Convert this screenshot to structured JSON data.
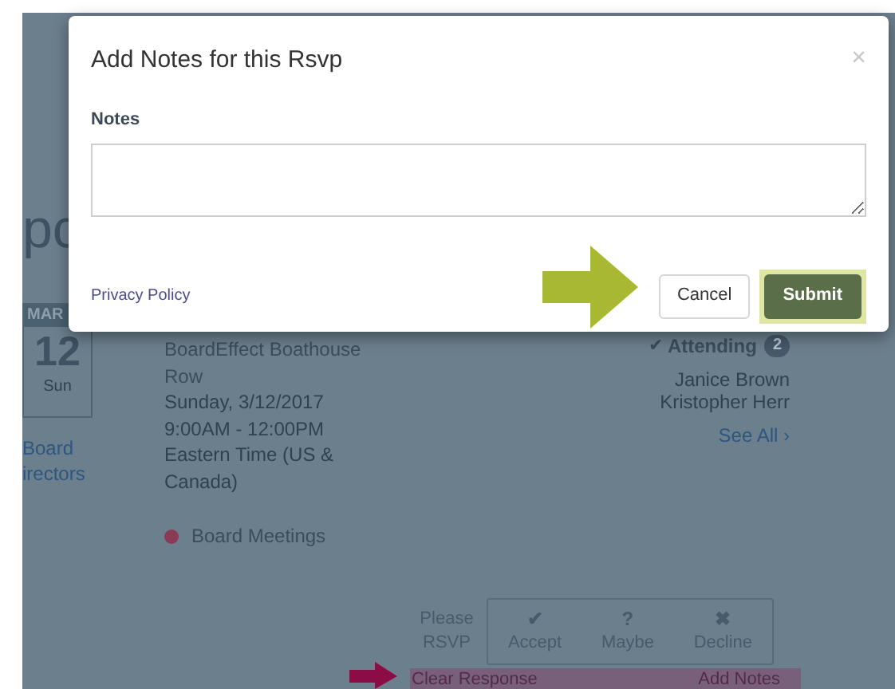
{
  "page": {
    "title_fragment": "pc",
    "date": {
      "month": "MAR",
      "day": "12",
      "weekday": "Sun"
    },
    "group_link": {
      "lines": [
        "Board",
        "irectors"
      ]
    },
    "event": {
      "location": "BoardEffect Boathouse Row",
      "date": "Sunday, 3/12/2017",
      "time": "9:00AM - 12:00PM",
      "timezone": "Eastern Time (US & Canada)"
    },
    "category": {
      "label": "Board Meetings",
      "color": "#8a3a55"
    },
    "attending": {
      "label": "Attending",
      "count": "2",
      "names": [
        "Janice Brown",
        "Kristopher Herr"
      ],
      "see_all": "See All ›"
    },
    "rsvp": {
      "prompt": "Please RSVP",
      "options": [
        {
          "icon": "✔",
          "label": "Accept"
        },
        {
          "icon": "?",
          "label": "Maybe"
        },
        {
          "icon": "✖",
          "label": "Decline"
        }
      ],
      "clear": "Clear Response",
      "add_notes": "Add Notes"
    }
  },
  "modal": {
    "title": "Add Notes for this Rsvp",
    "close": "×",
    "notes_label": "Notes",
    "privacy_link": "Privacy Policy",
    "buttons": [
      {
        "label": "Cancel",
        "kind": "secondary",
        "highlighted": false
      },
      {
        "label": "Submit",
        "kind": "primary",
        "highlighted": true
      }
    ]
  }
}
